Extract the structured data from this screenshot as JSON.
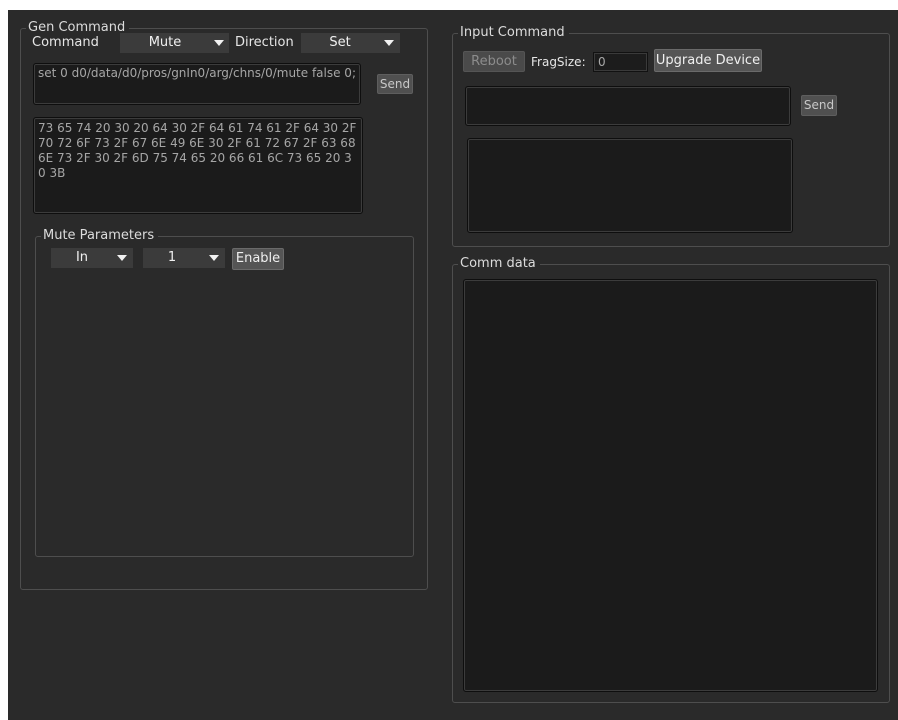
{
  "gen_command": {
    "title": "Gen Command",
    "command_label": "Command",
    "command_value": "Mute",
    "direction_label": "Direction",
    "direction_value": "Set",
    "command_text": "set 0 d0/data/d0/pros/gnIn0/arg/chns/0/mute false 0;",
    "send_label": "Send",
    "hex_text": "73 65 74 20 30 20 64 30 2F 64 61 74 61 2F 64 30 2F 70 72 6F 73 2F 67 6E 49 6E 30 2F 61 72 67 2F 63 68 6E 73 2F 30 2F 6D 75 74 65 20 66 61 6C 73 65 20 30 3B"
  },
  "mute_parameters": {
    "title": "Mute Parameters",
    "io_value": "In",
    "channel_value": "1",
    "enable_label": "Enable"
  },
  "input_command": {
    "title": "Input Command",
    "reboot_label": "Reboot",
    "fragsize_label": "FragSize:",
    "fragsize_value": "0",
    "upgrade_label": "Upgrade Device",
    "send_label": "Send"
  },
  "comm_data": {
    "title": "Comm data"
  },
  "icons": {
    "dropdown": "chevron-down-icon"
  },
  "colors": {
    "background": "#2a2a2a",
    "field_background": "#1b1b1b",
    "button": "#555555"
  }
}
